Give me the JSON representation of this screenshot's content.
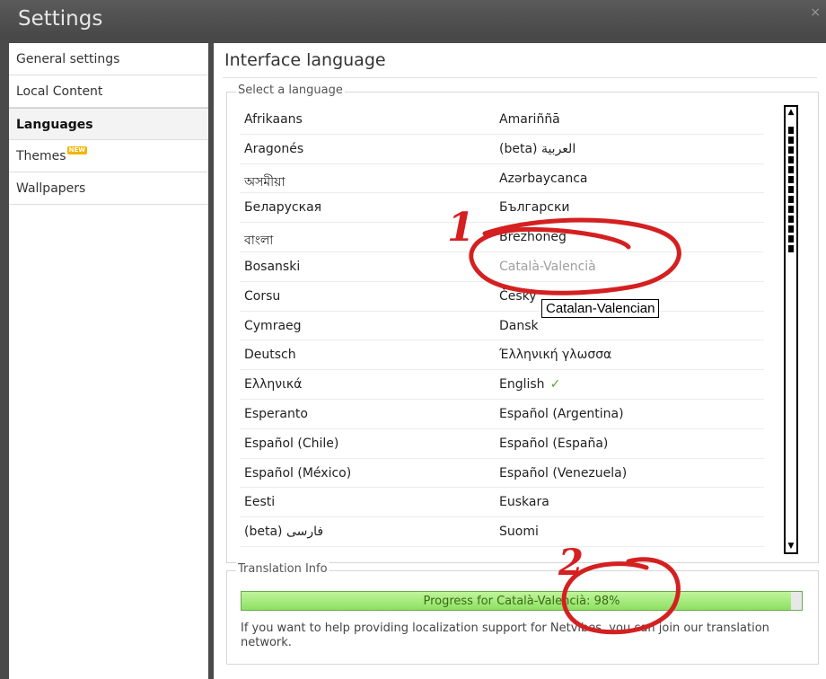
{
  "window": {
    "title": "Settings",
    "close_glyph": "×"
  },
  "sidebar": {
    "items": [
      {
        "label": "General settings"
      },
      {
        "label": "Local Content"
      },
      {
        "label": "Languages",
        "active": true
      },
      {
        "label": "Themes",
        "badge": "NEW"
      },
      {
        "label": "Wallpapers"
      }
    ]
  },
  "main": {
    "heading": "Interface language",
    "select_legend": "Select a language",
    "languages": [
      [
        "Afrikaans",
        "Amariññā"
      ],
      [
        "Aragonés",
        "(beta) العربية"
      ],
      [
        "অসমীয়া",
        "Azərbaycanca"
      ],
      [
        "Беларуская",
        "Български"
      ],
      [
        "বাংলা",
        "Brezhoneg"
      ],
      [
        "Bosanski",
        "Català-Valencià"
      ],
      [
        "Corsu",
        "Česky"
      ],
      [
        "Cymraeg",
        "Dansk"
      ],
      [
        "Deutsch",
        "Έλληνική γλωσσα"
      ],
      [
        "Ελληνικά",
        "English"
      ],
      [
        "Esperanto",
        "Español (Argentina)"
      ],
      [
        "Español (Chile)",
        "Español (España)"
      ],
      [
        "Español (México)",
        "Español (Venezuela)"
      ],
      [
        "Eesti",
        "Euskara"
      ],
      [
        "(beta) فارسی",
        "Suomi"
      ]
    ],
    "selected_language": "English",
    "hovered_language": "Català-Valencià",
    "tooltip": "Catalan-Valencian",
    "translation_legend": "Translation Info",
    "progress_text": "Progress for Català-Valencià: 98%",
    "progress_value": 0.98,
    "info_text": "If you want to help providing localization support for Netvibes, you can join our translation network."
  },
  "annotations": {
    "marker_1": "1",
    "marker_2": "2",
    "color": "#d42020"
  },
  "colors": {
    "progress_fill": "#8ee063",
    "check": "#59a82a",
    "titlebar": "#4a4a4a"
  }
}
